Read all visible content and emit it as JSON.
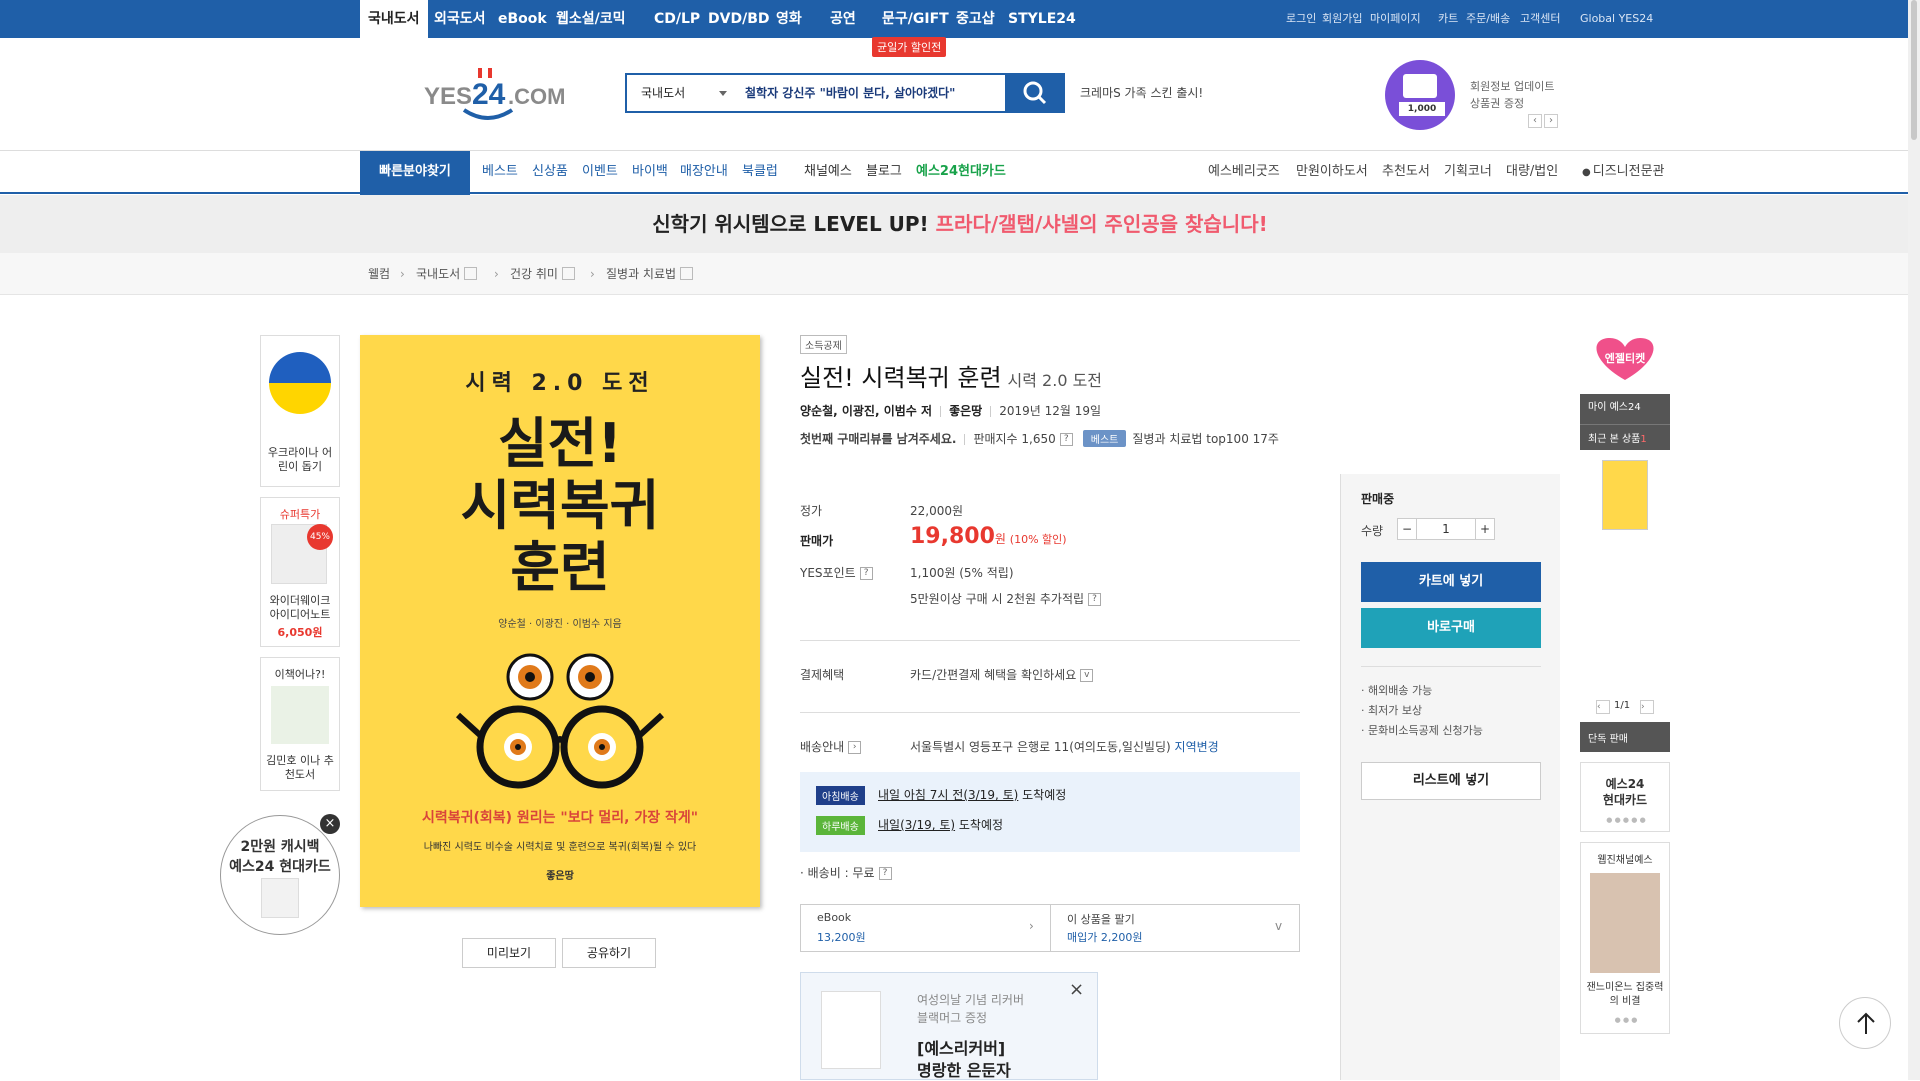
{
  "topnav": {
    "tabs": [
      "국내도서",
      "외국도서",
      "eBook",
      "웹소설/코믹",
      "CD/LP",
      "DVD/BD",
      "영화",
      "공연",
      "문구/GIFT",
      "중고샵",
      "STYLE24"
    ],
    "hot_badge": "균일가 할인전",
    "right_links": [
      "로그인",
      "회원가입",
      "마이페이지",
      "카트",
      "주문/배송",
      "고객센터",
      "Global YES24"
    ]
  },
  "header": {
    "logo_text": "YES24.COM",
    "search_category": "국내도서",
    "search_keyword": "철학자 강신주 \"바람이 분다, 살아야겠다\"",
    "promo_text": "크레마S 가족 스킨 출시!",
    "side_promo_line1": "회원정보 업데이트",
    "side_promo_line2": "상품권 증정",
    "side_promo_amount": "1,000"
  },
  "nav2": {
    "quick": "빠른분야찾기",
    "left": [
      "베스트",
      "신상품",
      "이벤트",
      "바이백",
      "매장안내",
      "북클럽",
      "채널예스",
      "블로그",
      "예스24현대카드"
    ],
    "right": [
      "예스베리굿즈",
      "만원이하도서",
      "추천도서",
      "기획코너",
      "대량/법인",
      "디즈니전문관"
    ]
  },
  "banner": {
    "part1": "신학기 위시템으로 LEVEL UP! ",
    "part2": "프라다/갤탭/샤넬의 주인공을 찾습니다!"
  },
  "breadcrumb": [
    "웰컴",
    "국내도서",
    "건강 취미",
    "질병과 치료법"
  ],
  "left_side": {
    "ukraine": "우크라이나 어린이 돕기",
    "super_label": "슈퍼특가",
    "super_discount": "45%",
    "super_item": "와이더웨이크 아이디어노트",
    "super_price": "6,050원",
    "book_label": "이책어나?!",
    "book_item": "김민호 이나 추천도서",
    "card_line1": "2만원 캐시백",
    "card_line2": "예스24 현대카드"
  },
  "cover": {
    "top": "시력 2.0 도전",
    "title_l1": "실전!",
    "title_l2": "시력복귀",
    "title_l3": "훈련",
    "authors": "양순철 · 이광진 · 이범수 지음",
    "sub1": "시력복귀(회복) 원리는 \"보다 멀리, 가장 작게\"",
    "sub2": "나빠진 시력도 비수술 시력치료 및 훈련으로 복귀(회복)될 수 있다",
    "publisher": "좋은땅"
  },
  "cover_buttons": [
    "미리보기",
    "공유하기"
  ],
  "product": {
    "tag": "소득공제",
    "title": "실전! 시력복귀 훈련",
    "subtitle": "시력 2.0 도전",
    "authors": "양순철, 이광진, 이범수 저",
    "publisher": "좋은땅",
    "date": "2019년 12월 19일",
    "review_prompt": "첫번째 구매리뷰를 남겨주세요.",
    "sales_index": "판매지수 1,650",
    "best_badge": "베스트",
    "best_rank": "질병과 치료법 top100 17주"
  },
  "price": {
    "list_label": "정가",
    "list_price": "22,000원",
    "sale_label": "판매가",
    "sale_price": "19,800",
    "won": "원",
    "discount": "(10% 할인)",
    "points_label": "YES포인트",
    "points": "1,100원 (5% 적립)",
    "points_extra": "5만원이상 구매 시 2천원 추가적립",
    "pay_label": "결제혜택",
    "pay_text": "카드/간편결제 혜택을 확인하세요",
    "delivery_label": "배송안내",
    "address": "서울특별시 영등포구 은행로 11(여의도동,일신빌딩)",
    "change_area": "지역변경",
    "morning_badge": "아침배송",
    "morning_text": "내일 아침 7시 전(3/19, 토)",
    "morning_suffix": "도착예정",
    "day_badge": "하루배송",
    "day_text": "내일(3/19, 토)",
    "day_suffix": "도착예정",
    "shipping_fee": "· 배송비 : 무료"
  },
  "options": {
    "ebook_label": "eBook",
    "ebook_price": "13,200원",
    "sell_label": "이 상품을 팔기",
    "sell_price": "매입가 2,200원"
  },
  "buybox": {
    "status": "판매중",
    "qty_label": "수량",
    "qty": "1",
    "cart": "카트에 넣기",
    "buy": "바로구매",
    "notes": [
      "해외배송 가능",
      "최저가 보상",
      "문화비소득공제 신청가능"
    ],
    "wishlist": "리스트에 넣기"
  },
  "promo": {
    "line1": "여성의날 기념 리커버",
    "line2": "블랙머그 증정",
    "title1": "[예스리커버]",
    "title2": "명랑한 은둔자"
  },
  "right_side": {
    "angel": "엔젤티켓",
    "my": "마이 예스24",
    "recent": "최근 본 상품",
    "recent_count": "1",
    "pager": "1/1",
    "single": "단독 판매",
    "card1": "예스24",
    "card2": "현대카드",
    "channel_label": "웹진채널예스",
    "channel_item": "잰느미온느 집중력의 비결"
  },
  "colors": {
    "brand": "#1f5fa8",
    "sale": "#e8382f",
    "teal": "#1fa2b8"
  }
}
